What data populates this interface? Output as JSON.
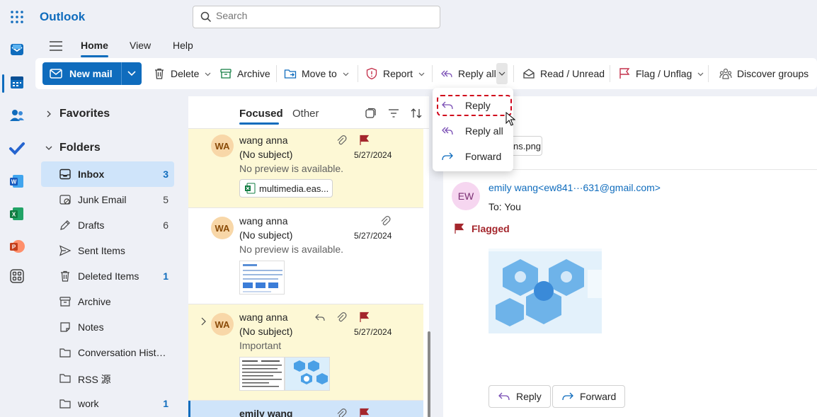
{
  "app": {
    "title": "Outlook"
  },
  "search": {
    "placeholder": "Search"
  },
  "ribbon_tabs": [
    "Home",
    "View",
    "Help"
  ],
  "ribbon": {
    "new_mail": "New mail",
    "delete": "Delete",
    "archive": "Archive",
    "move_to": "Move to",
    "report": "Report",
    "reply_all": "Reply all",
    "read_unread": "Read / Unread",
    "flag_unflag": "Flag / Unflag",
    "discover_groups": "Discover groups"
  },
  "reply_menu": {
    "items": [
      "Reply",
      "Reply all",
      "Forward"
    ],
    "highlighted": "Reply"
  },
  "sidebar": {
    "favorites": "Favorites",
    "folders_header": "Folders",
    "folders": [
      {
        "name": "Inbox",
        "count": "3",
        "icon": "inbox-icon"
      },
      {
        "name": "Junk Email",
        "count": "5",
        "icon": "junk-icon"
      },
      {
        "name": "Drafts",
        "count": "6",
        "icon": "pencil-icon"
      },
      {
        "name": "Sent Items",
        "count": "",
        "icon": "send-icon"
      },
      {
        "name": "Deleted Items",
        "count": "1",
        "icon": "trash-icon"
      },
      {
        "name": "Archive",
        "count": "",
        "icon": "archive-icon"
      },
      {
        "name": "Notes",
        "count": "",
        "icon": "note-icon"
      },
      {
        "name": "Conversation History",
        "count": "",
        "icon": "folder-icon"
      },
      {
        "name": "RSS 源",
        "count": "",
        "icon": "folder-icon"
      },
      {
        "name": "work",
        "count": "1",
        "icon": "folder-icon"
      }
    ]
  },
  "mail_list": {
    "tabs": [
      "Focused",
      "Other"
    ],
    "messages": [
      {
        "avatar": "WA",
        "from": "wang anna",
        "subject": "(No subject)",
        "preview": "No preview is available.",
        "date": "5/27/2024",
        "attachment": "multimedia.eas..."
      },
      {
        "avatar": "WA",
        "from": "wang anna",
        "subject": "(No subject)",
        "preview": "No preview is available.",
        "date": "5/27/2024"
      },
      {
        "avatar": "WA",
        "from": "wang anna",
        "subject": "(No subject)",
        "preview": "Important",
        "date": "5/27/2024"
      },
      {
        "from": "emily wang"
      }
    ]
  },
  "reading": {
    "attachment_chip": "ns.png",
    "avatar": "EW",
    "sender": "emily wang<ew841···631@gmail.com>",
    "to": "To:  You",
    "flag_label": "Flagged",
    "reply_button": "Reply",
    "forward_button": "Forward"
  },
  "colors": {
    "accent": "#0f6cbd",
    "flag": "#a4262c",
    "highlight_flagged": "#fdf8d5",
    "selected": "#cfe4fa"
  }
}
